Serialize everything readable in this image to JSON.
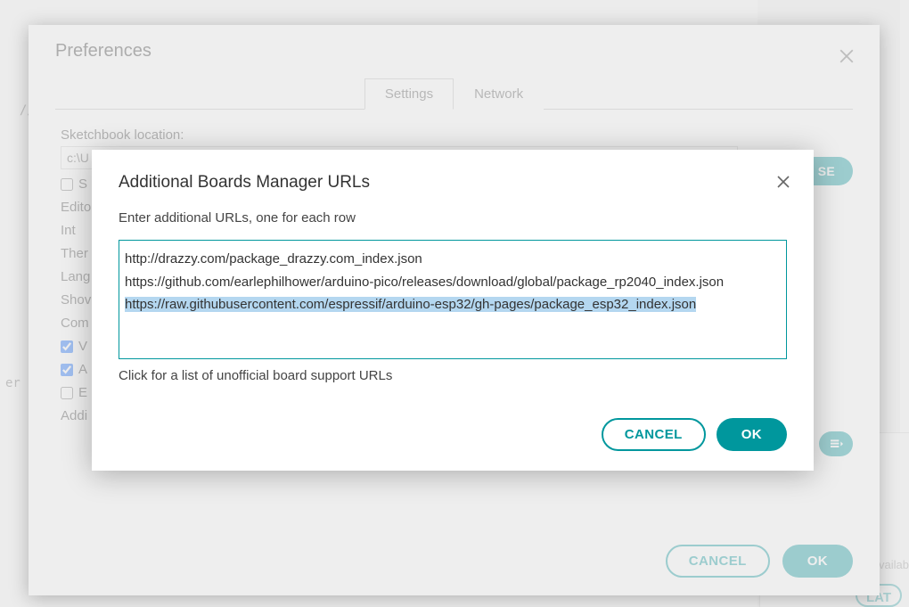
{
  "background": {
    "code_fragment_1": "//s",
    "code_fragment_2": "  /",
    "code_fragment_3": "er",
    "available_text": "vailab",
    "lat_button": "LAT"
  },
  "prefs": {
    "title": "Preferences",
    "tabs": {
      "settings": "Settings",
      "network": "Network"
    },
    "sketchbook_label": "Sketchbook location:",
    "sketchbook_path": "c:\\U",
    "browse": "SE",
    "labels": {
      "s_line": "S",
      "editor": "Edito",
      "interf": "Int",
      "theme": "Ther",
      "lang": "Lang",
      "show": "Shov",
      "com": "Com",
      "v_line": "V",
      "a_line": "A",
      "e_line": "E",
      "addi": "Addi"
    },
    "footer": {
      "cancel": "CANCEL",
      "ok": "OK"
    }
  },
  "inner": {
    "title": "Additional Boards Manager URLs",
    "subtitle": "Enter additional URLs, one for each row",
    "urls": [
      "http://drazzy.com/package_drazzy.com_index.json",
      "https://github.com/earlephilhower/arduino-pico/releases/download/global/package_rp2040_index.json",
      "https://raw.githubusercontent.com/espressif/arduino-esp32/gh-pages/package_esp32_index.json"
    ],
    "selected_index": 2,
    "help": "Click for a list of unofficial board support URLs",
    "footer": {
      "cancel": "CANCEL",
      "ok": "OK"
    }
  }
}
